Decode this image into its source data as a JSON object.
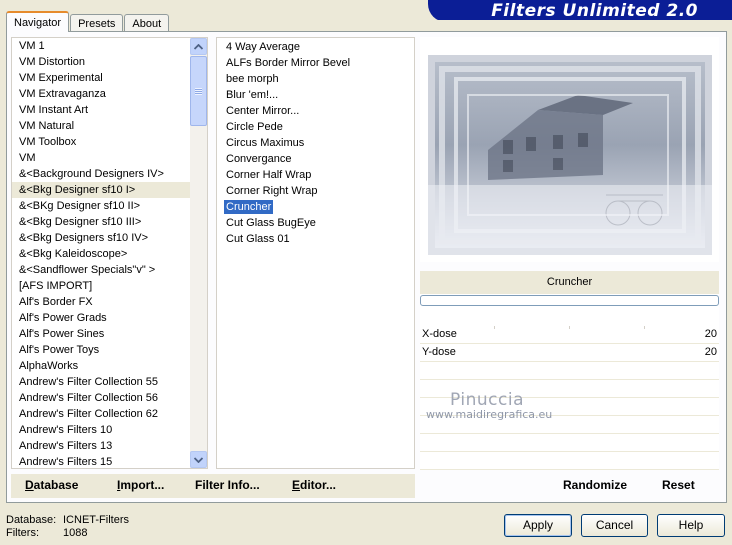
{
  "banner": {
    "title": "Filters Unlimited 2.0"
  },
  "tabs": [
    {
      "label": "Navigator",
      "active": true
    },
    {
      "label": "Presets",
      "active": false
    },
    {
      "label": "About",
      "active": false
    }
  ],
  "categories": [
    "VM 1",
    "VM Distortion",
    "VM Experimental",
    "VM Extravaganza",
    "VM Instant Art",
    "VM Natural",
    "VM Toolbox",
    "VM",
    "&<Background Designers IV>",
    "&<Bkg Designer sf10 I>",
    "&<BKg Designer sf10 II>",
    "&<Bkg Designer sf10 III>",
    "&<Bkg Designers sf10 IV>",
    "&<Bkg Kaleidoscope>",
    "&<Sandflower Specials\"v\" >",
    "[AFS IMPORT]",
    "Alf's Border FX",
    "Alf's Power Grads",
    "Alf's Power Sines",
    "Alf's Power Toys",
    "AlphaWorks",
    "Andrew's Filter Collection 55",
    "Andrew's Filter Collection 56",
    "Andrew's Filter Collection 62",
    "Andrew's Filters 10",
    "Andrew's Filters 13",
    "Andrew's Filters 15"
  ],
  "selected_category_index": 9,
  "filters": [
    "4 Way Average",
    "ALFs Border Mirror Bevel",
    "bee morph",
    "Blur 'em!...",
    "Center Mirror...",
    "Circle Pede",
    "Circus Maximus",
    "Convergance",
    "Corner Half Wrap",
    "Corner Right Wrap",
    "Cruncher",
    "Cut Glass  BugEye",
    "Cut Glass 01"
  ],
  "selected_filter_index": 10,
  "params": {
    "filter_name": "Cruncher",
    "rows": [
      {
        "label": "X-dose",
        "value": "20"
      },
      {
        "label": "Y-dose",
        "value": "20"
      }
    ]
  },
  "watermark": {
    "name": "Pinuccia",
    "site": "www.maidiregrafica.eu"
  },
  "toolbar": {
    "database": {
      "underline": "D",
      "rest": "atabase"
    },
    "import": {
      "underline": "I",
      "rest": "mport..."
    },
    "filter_info": {
      "underline": "Filter I",
      "rest": "nfo..."
    },
    "editor": {
      "underline": "E",
      "rest": "ditor..."
    },
    "randomize": "Randomize",
    "reset": "Reset"
  },
  "info": {
    "database_label": "Database:",
    "database_value": "ICNET-Filters",
    "filters_label": "Filters:",
    "filters_value": "1088"
  },
  "buttons": {
    "apply": "Apply",
    "cancel": "Cancel",
    "help": "Help"
  },
  "colors": {
    "banner": "#0b1e96",
    "selection": "#316ac5",
    "tab_highlight": "#e68b2c"
  }
}
